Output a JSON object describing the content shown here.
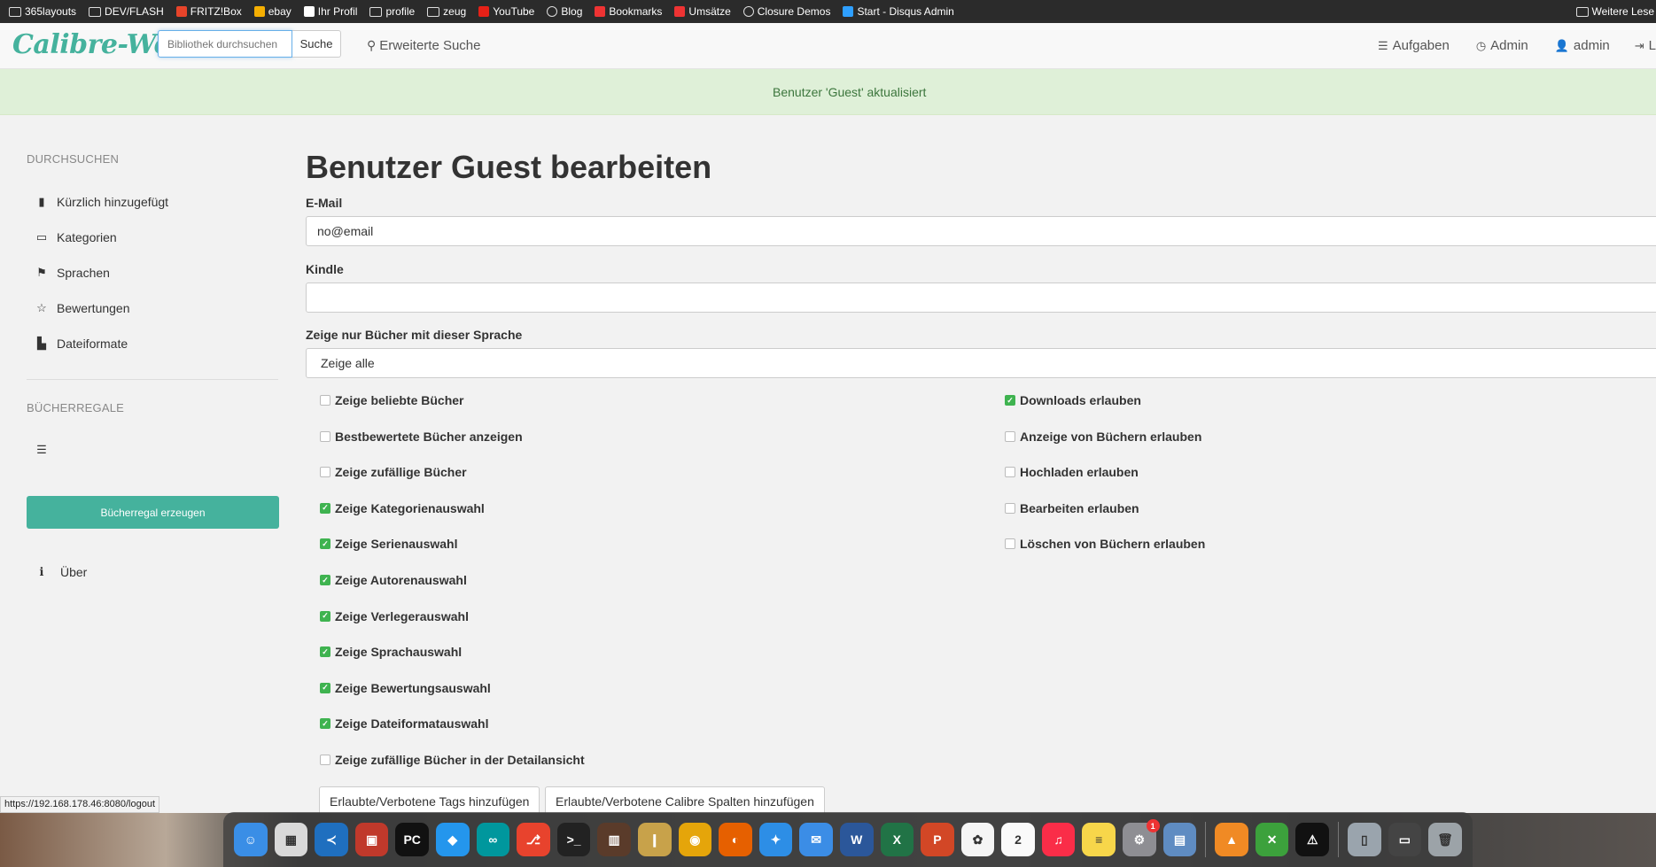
{
  "bookmarks": {
    "items": [
      {
        "label": "365layouts",
        "icon": "folder-icon"
      },
      {
        "label": "DEV/FLASH",
        "icon": "folder-icon"
      },
      {
        "label": "FRITZ!Box",
        "icon": "fritzbox-icon"
      },
      {
        "label": "ebay",
        "icon": "ebay-icon"
      },
      {
        "label": "Ihr Profil",
        "icon": "amazon-icon"
      },
      {
        "label": "profile",
        "icon": "folder-icon"
      },
      {
        "label": "zeug",
        "icon": "folder-icon"
      },
      {
        "label": "YouTube",
        "icon": "youtube-icon"
      },
      {
        "label": "Blog",
        "icon": "globe-icon"
      },
      {
        "label": "Bookmarks",
        "icon": "bookmarks-icon"
      },
      {
        "label": "Umsätze",
        "icon": "bank-icon"
      },
      {
        "label": "Closure Demos",
        "icon": "globe-icon"
      },
      {
        "label": "Start - Disqus Admin",
        "icon": "disqus-icon"
      }
    ],
    "other": "Weitere Lese"
  },
  "navbar": {
    "logo": "Calibre-Web",
    "search_placeholder": "Bibliothek durchsuchen",
    "search_button": "Suche",
    "advanced_search": "Erweiterte Suche",
    "tasks": "Aufgaben",
    "admin": "Admin",
    "user": "admin",
    "logout": "L"
  },
  "alert": {
    "message": "Benutzer 'Guest' aktualisiert"
  },
  "sidebar": {
    "browse_heading": "DURCHSUCHEN",
    "items": [
      {
        "label": "Kürzlich hinzugefügt",
        "icon": "book-icon"
      },
      {
        "label": "Kategorien",
        "icon": "inbox-icon"
      },
      {
        "label": "Sprachen",
        "icon": "flag-icon"
      },
      {
        "label": "Bewertungen",
        "icon": "star-icon"
      },
      {
        "label": "Dateiformate",
        "icon": "file-icon"
      }
    ],
    "shelves_heading": "BÜCHERREGALE",
    "create_shelf": "Bücherregal erzeugen",
    "about": "Über"
  },
  "main": {
    "title": "Benutzer Guest bearbeiten",
    "email_label": "E-Mail",
    "email_value": "no@email",
    "kindle_label": "Kindle",
    "kindle_value": "",
    "language_label": "Zeige nur Bücher mit dieser Sprache",
    "language_value": "Zeige alle",
    "left_checks": [
      {
        "label": "Zeige beliebte Bücher",
        "checked": false
      },
      {
        "label": "Bestbewertete Bücher anzeigen",
        "checked": false
      },
      {
        "label": "Zeige zufällige Bücher",
        "checked": false
      },
      {
        "label": "Zeige Kategorienauswahl",
        "checked": true
      },
      {
        "label": "Zeige Serienauswahl",
        "checked": true
      },
      {
        "label": "Zeige Autorenauswahl",
        "checked": true
      },
      {
        "label": "Zeige Verlegerauswahl",
        "checked": true
      },
      {
        "label": "Zeige Sprachauswahl",
        "checked": true
      },
      {
        "label": "Zeige Bewertungsauswahl",
        "checked": true
      },
      {
        "label": "Zeige Dateiformatauswahl",
        "checked": true
      },
      {
        "label": "Zeige zufällige Bücher in der Detailansicht",
        "checked": false
      }
    ],
    "right_checks": [
      {
        "label": "Downloads erlauben",
        "checked": true
      },
      {
        "label": "Anzeige von Büchern erlauben",
        "checked": false
      },
      {
        "label": "Hochladen erlauben",
        "checked": false
      },
      {
        "label": "Bearbeiten erlauben",
        "checked": false
      },
      {
        "label": "Löschen von Büchern erlauben",
        "checked": false
      }
    ],
    "btn_tags": "Erlaubte/Verbotene Tags hinzufügen",
    "btn_columns": "Erlaubte/Verbotene Calibre Spalten hinzufügen"
  },
  "status_url": "https://192.168.178.46:8080/logout",
  "dock": {
    "apps": [
      {
        "name": "finder-icon",
        "color": "#3a8ee6",
        "glyph": "☺"
      },
      {
        "name": "launchpad-icon",
        "color": "#d9d9d9",
        "glyph": "▦"
      },
      {
        "name": "vscode-icon",
        "color": "#1f6fbf",
        "glyph": "≺"
      },
      {
        "name": "remote-desktop-icon",
        "color": "#c0392b",
        "glyph": "▣"
      },
      {
        "name": "pycharm-icon",
        "color": "#111",
        "glyph": "PC"
      },
      {
        "name": "docker-icon",
        "color": "#2496ed",
        "glyph": "◆"
      },
      {
        "name": "arduino-icon",
        "color": "#00979d",
        "glyph": "∞"
      },
      {
        "name": "git-icon",
        "color": "#e8432d",
        "glyph": "⎇"
      },
      {
        "name": "terminal-icon",
        "color": "#222",
        "glyph": ">_"
      },
      {
        "name": "calibre-icon",
        "color": "#5a3b2a",
        "glyph": "▥"
      },
      {
        "name": "books-icon",
        "color": "#c8a24a",
        "glyph": "❙"
      },
      {
        "name": "chrome-icon",
        "color": "#e5a50a",
        "glyph": "◉"
      },
      {
        "name": "firefox-icon",
        "color": "#e66000",
        "glyph": "◐"
      },
      {
        "name": "safari-icon",
        "color": "#2d8ee6",
        "glyph": "✦"
      },
      {
        "name": "mail-icon",
        "color": "#3b8de6",
        "glyph": "✉"
      },
      {
        "name": "word-icon",
        "color": "#2b579a",
        "glyph": "W"
      },
      {
        "name": "excel-icon",
        "color": "#217346",
        "glyph": "X"
      },
      {
        "name": "powerpoint-icon",
        "color": "#d24726",
        "glyph": "P"
      },
      {
        "name": "photos-icon",
        "color": "#f5f5f5",
        "glyph": "✿"
      },
      {
        "name": "calendar-icon",
        "color": "#fafafa",
        "glyph": "2"
      },
      {
        "name": "music-icon",
        "color": "#fa2d48",
        "glyph": "♫"
      },
      {
        "name": "notes-icon",
        "color": "#f7d64a",
        "glyph": "≡"
      },
      {
        "name": "system-preferences-icon",
        "color": "#8e8e93",
        "glyph": "⚙",
        "badge": "1"
      },
      {
        "name": "preview-icon",
        "color": "#5f8cc2",
        "glyph": "▤"
      },
      {
        "name": "vlc-icon",
        "color": "#f08a24",
        "glyph": "▲"
      },
      {
        "name": "xcode-tool-icon",
        "color": "#3ca13c",
        "glyph": "✕"
      },
      {
        "name": "console-icon",
        "color": "#111",
        "glyph": "⚠"
      },
      {
        "name": "documents-folder-icon",
        "color": "#9aa4ad",
        "glyph": "▯"
      },
      {
        "name": "downloads-stack-icon",
        "color": "#444",
        "glyph": "▭"
      },
      {
        "name": "trash-icon",
        "color": "#9ca3a8",
        "glyph": "🗑"
      }
    ]
  }
}
